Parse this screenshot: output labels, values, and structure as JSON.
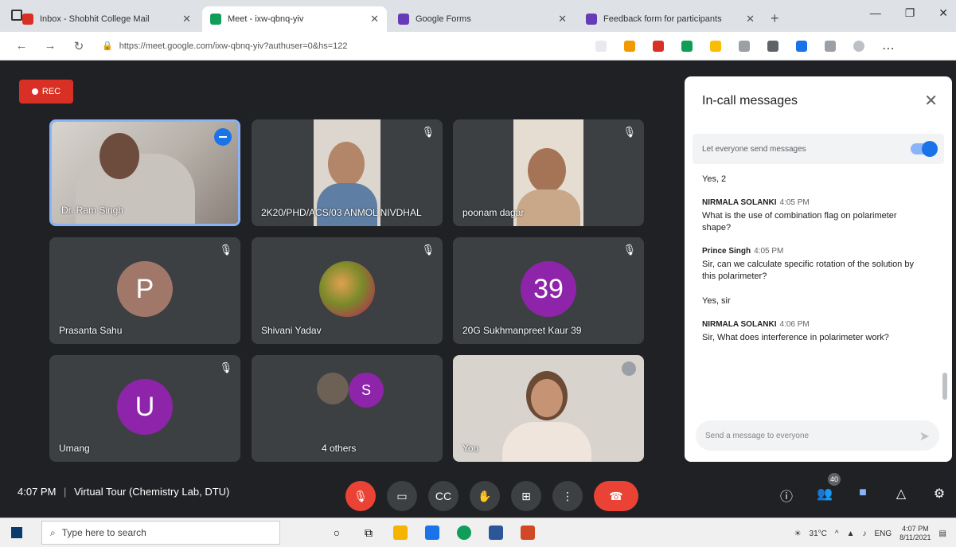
{
  "browser": {
    "tabs": [
      {
        "title": "Inbox - Shobhit College Mail",
        "color": "#d93025",
        "active": false
      },
      {
        "title": "Meet - ixw-qbnq-yiv",
        "color": "#0f9d58",
        "active": true
      },
      {
        "title": "Google Forms",
        "color": "#673ab7",
        "active": false
      },
      {
        "title": "Feedback form for participants",
        "color": "#673ab7",
        "active": false
      }
    ],
    "new_tab": "+",
    "url": "https://meet.google.com/ixw-qbnq-yiv?authuser=0&hs=122",
    "window_controls": [
      "—",
      "❐",
      "✕"
    ]
  },
  "meeting": {
    "rec_label": "REC",
    "time": "4:07 PM",
    "separator": "|",
    "title": "Virtual Tour (Chemistry Lab, DTU)",
    "participant_count": "40",
    "participants": [
      {
        "name": "Dr. Ram Singh",
        "type": "video",
        "speaking": true
      },
      {
        "name": "2K20/PHD/ACS/03 ANMOL NIVDHAL",
        "type": "video",
        "muted": true
      },
      {
        "name": "poonam dagar",
        "type": "video",
        "muted": true
      },
      {
        "name": "Prasanta Sahu",
        "type": "avatar",
        "initial": "P",
        "color": "#a1776a",
        "muted": true
      },
      {
        "name": "Shivani Yadav",
        "type": "photo",
        "muted": true
      },
      {
        "name": "20G Sukhmanpreet Kaur 39",
        "type": "avatar",
        "initial": "39",
        "color": "#8e24aa",
        "muted": true
      },
      {
        "name": "Umang",
        "type": "avatar",
        "initial": "U",
        "color": "#8e24aa",
        "muted": true
      },
      {
        "name": "4 others",
        "type": "group",
        "initial": "S",
        "color": "#8e24aa"
      },
      {
        "name": "You",
        "type": "video"
      }
    ]
  },
  "chat": {
    "title": "In-call messages",
    "close": "✕",
    "toggle_label": "Let everyone send messages",
    "messages": [
      {
        "sender": "",
        "time": "",
        "text": "Yes, 2"
      },
      {
        "sender": "NIRMALA SOLANKI",
        "time": "4:05 PM",
        "text": "What is the use of combination flag on polarimeter shape?"
      },
      {
        "sender": "Prince Singh",
        "time": "4:05 PM",
        "text": "Sir, can we calculate specific rotation of the solution by this polarimeter?"
      },
      {
        "sender": "",
        "time": "",
        "text": "Yes, sir"
      },
      {
        "sender": "NIRMALA SOLANKI",
        "time": "4:06 PM",
        "text": "Sir, What does interference in polarimeter work?"
      }
    ],
    "compose_placeholder": "Send a message to everyone",
    "send_icon": "➤"
  },
  "taskbar": {
    "search_placeholder": "Type here to search",
    "temperature": "31°C",
    "lang": "ENG",
    "time": "4:07 PM",
    "date": "8/11/2021"
  }
}
